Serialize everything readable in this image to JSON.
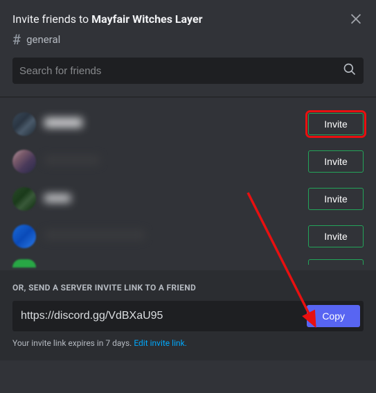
{
  "header": {
    "title_prefix": "Invite friends to ",
    "title_server": "Mayfair Witches Layer",
    "channel": "general",
    "search_placeholder": "Search for friends"
  },
  "friends": {
    "invite_label": "Invite"
  },
  "footer": {
    "title": "OR, SEND A SERVER INVITE LINK TO A FRIEND",
    "link": "https://discord.gg/VdBXaU95",
    "copy_label": "Copy",
    "expire_text": "Your invite link expires in 7 days. ",
    "edit_label": "Edit invite link."
  }
}
